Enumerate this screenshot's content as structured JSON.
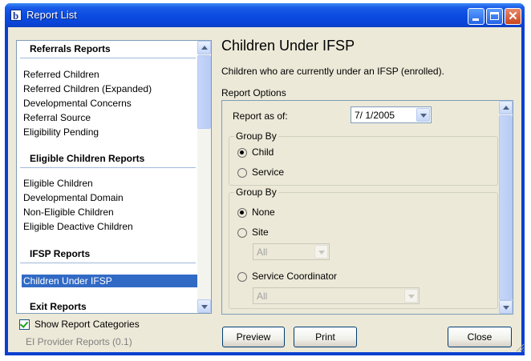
{
  "window": {
    "title": "Report List",
    "app_icon": "b"
  },
  "report_list": {
    "categories": [
      {
        "header": "Referrals Reports",
        "items": [
          "Referred Children",
          "Referred Children (Expanded)",
          "Developmental Concerns",
          "Referral Source",
          "Eligibility Pending"
        ]
      },
      {
        "header": "Eligible Children Reports",
        "items": [
          "Eligible Children",
          "Developmental Domain",
          "Non-Eligible Children",
          "Eligible Deactive Children"
        ]
      },
      {
        "header": "IFSP Reports",
        "items": [
          "Children Under IFSP"
        ]
      },
      {
        "header": "Exit Reports",
        "items": []
      }
    ],
    "selected": "Children Under IFSP"
  },
  "show_categories": {
    "label": "Show Report Categories",
    "checked": true
  },
  "version_label": "EI Provider Reports (0.1)",
  "report": {
    "title": "Children Under IFSP",
    "description": "Children who are currently under an IFSP (enrolled).",
    "options_label": "Report Options"
  },
  "options": {
    "report_as_of_label": "Report as of:",
    "report_as_of_value": "7/  1/2005",
    "group_by_1": {
      "legend": "Group By",
      "child": "Child",
      "service": "Service",
      "selected": "Child"
    },
    "group_by_2": {
      "legend": "Group By",
      "none": "None",
      "site": "Site",
      "site_value": "All",
      "service_coordinator": "Service Coordinator",
      "service_coordinator_value": "All",
      "selected": "None"
    }
  },
  "buttons": {
    "preview": "Preview",
    "print": "Print",
    "close": "Close"
  },
  "colors": {
    "selection": "#316ac5",
    "titlebar": "#0a4be0",
    "face": "#ece9d8"
  }
}
